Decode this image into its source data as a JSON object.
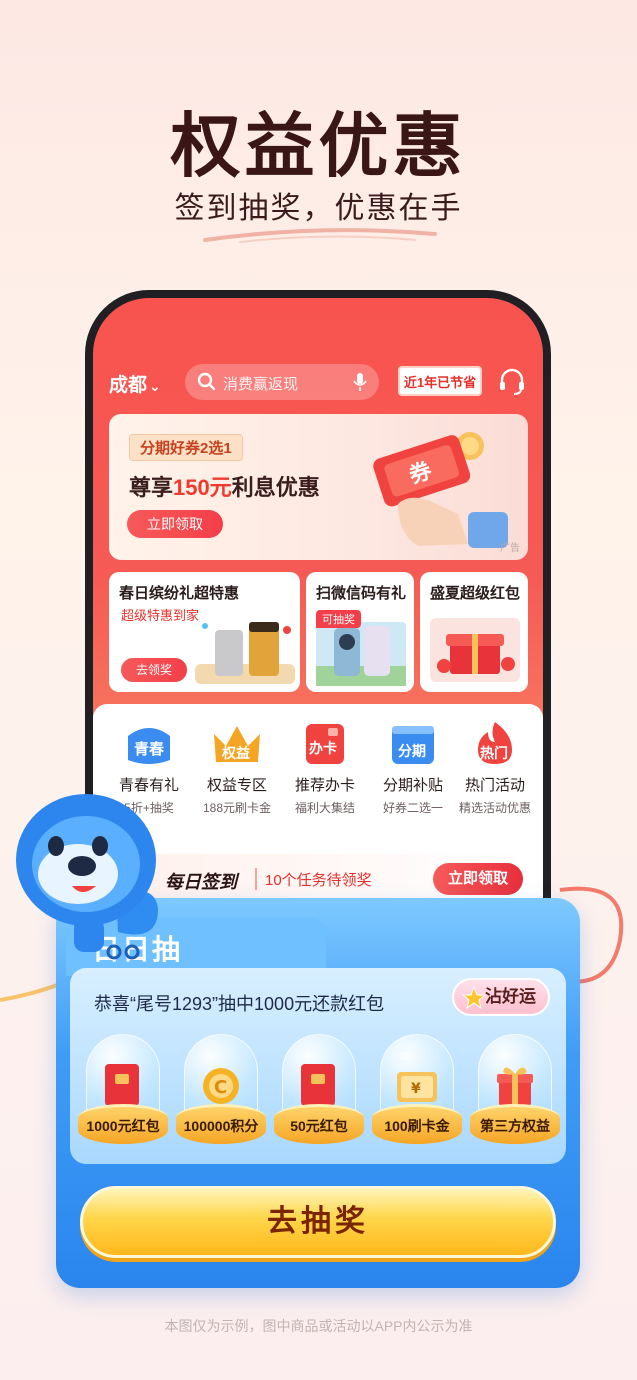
{
  "hero": {
    "title": "权益优惠",
    "subtitle": "签到抽奖，优惠在手"
  },
  "topbar": {
    "city": "成都",
    "search_placeholder": "消费赢返现",
    "saved_badge": "近1年已节省"
  },
  "promo_banner": {
    "tag": "分期好券2选1",
    "title_prefix": "尊享",
    "title_highlight": "150元",
    "title_suffix": "利息优惠",
    "button": "立即领取",
    "coupon_text": "券",
    "ad_label": "广告"
  },
  "cards": [
    {
      "title": "春日缤纷礼超特惠",
      "subtitle": "超级特惠到家",
      "button": "去领奖"
    },
    {
      "title": "扫微信码有礼",
      "badge": "可抽奖"
    },
    {
      "title": "盛夏超级红包"
    }
  ],
  "services": [
    {
      "icon_text": "青春",
      "label": "青春有礼",
      "sub": "5折+抽奖",
      "color": "#3b8cf0"
    },
    {
      "icon_text": "权益",
      "label": "权益专区",
      "sub": "188元刷卡金",
      "color": "#f5a524"
    },
    {
      "icon_text": "办卡",
      "label": "推荐办卡",
      "sub": "福利大集结",
      "color": "#f0433f"
    },
    {
      "icon_text": "分期",
      "label": "分期补贴",
      "sub": "好券二选一",
      "color": "#3b8cf0"
    },
    {
      "icon_text": "热门",
      "label": "热门活动",
      "sub": "精选活动优惠",
      "color": "#f0433f"
    }
  ],
  "checkin": {
    "title": "每日签到",
    "tasks": "10个任务待领奖",
    "button": "立即领取"
  },
  "draw": {
    "title": "日日抽",
    "winner_text": "恭喜“尾号1293”抽中1000元还款红包",
    "luck_button": "沾好运",
    "prizes": [
      "1000元红包",
      "100000积分",
      "50元红包",
      "100刷卡金",
      "第三方权益"
    ],
    "go_button": "去抽奖",
    "coin_symbol": "C",
    "cash_symbol": "¥"
  },
  "disclaimer": "本图仅为示例，图中商品或活动以APP内公示为准"
}
